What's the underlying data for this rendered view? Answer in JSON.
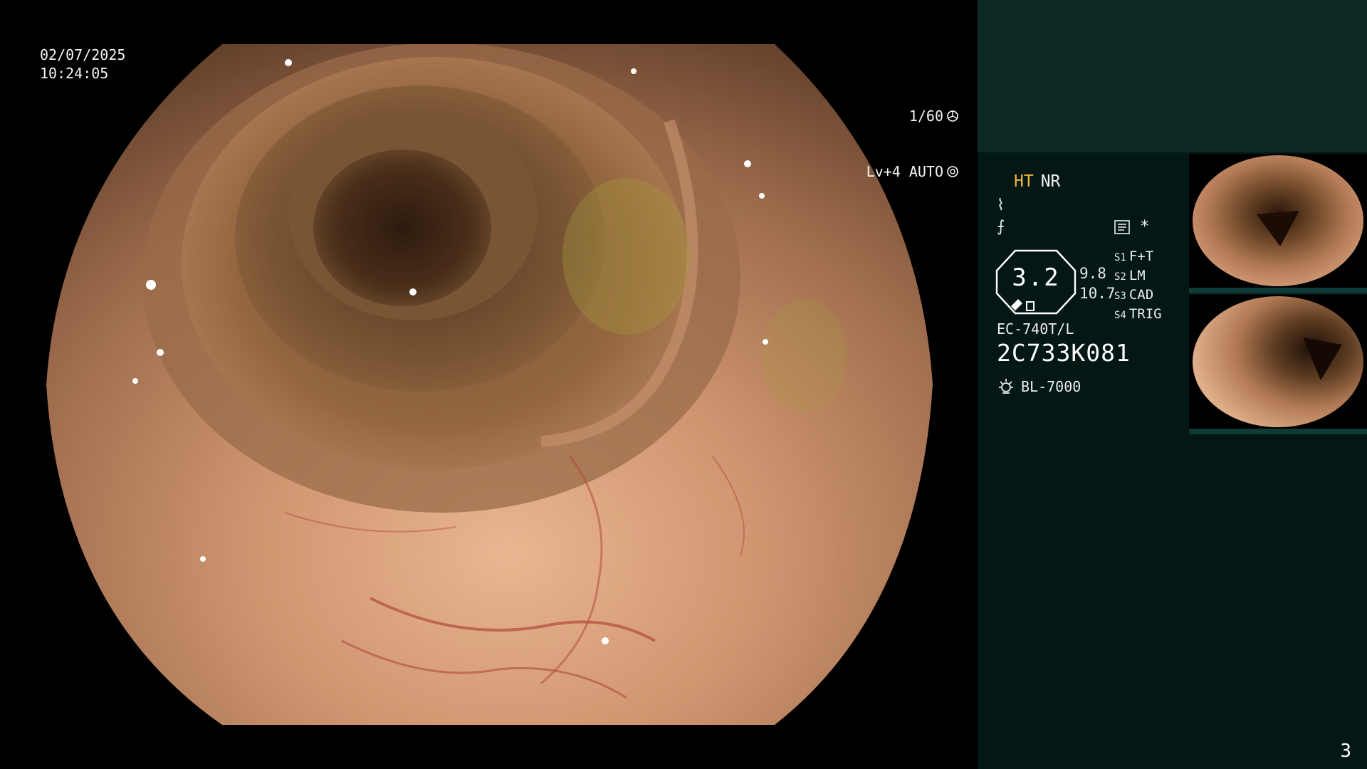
{
  "overlay": {
    "date": "02/07/2025",
    "time": "10:24:05",
    "shutter": "1/60",
    "level": "Lv+4 AUTO"
  },
  "panel": {
    "mode_ht": "HT",
    "mode_nr": "NR",
    "glyph_1": "⌇",
    "glyph_2": "⨍",
    "zoom_value": "3.2",
    "zoom_side_1": "9.8",
    "zoom_side_2": "10.7",
    "switches": [
      {
        "key": "S1",
        "value": "F+T"
      },
      {
        "key": "S2",
        "value": "LM"
      },
      {
        "key": "S3",
        "value": "CAD"
      },
      {
        "key": "S4",
        "value": "TRIG"
      }
    ],
    "asterisk": "*",
    "scope_model": "EC-740T/L",
    "serial": "2C733K081",
    "light_source": "BL-7000",
    "page_number": "3"
  },
  "colors": {
    "panel_bg": "#031714",
    "panel_top": "#0c2925",
    "ht_accent": "#f0b63a"
  }
}
